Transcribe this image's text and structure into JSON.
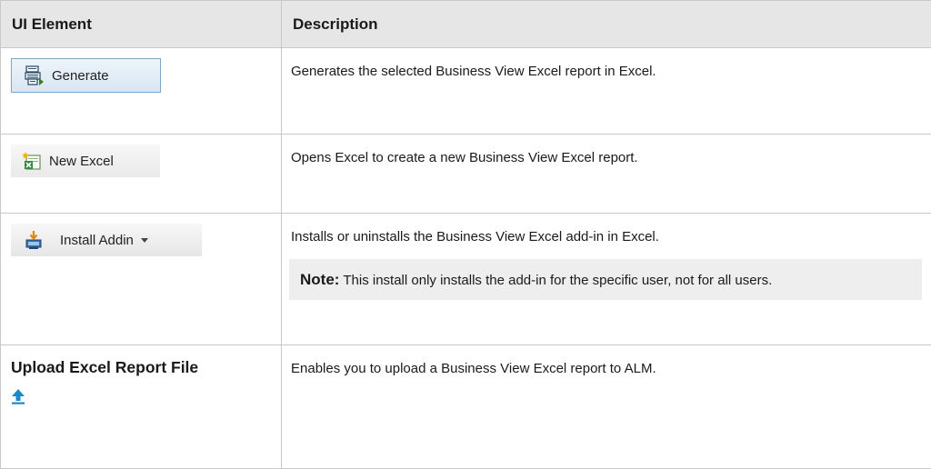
{
  "table": {
    "headers": [
      "UI Element",
      "Description"
    ],
    "rows": [
      {
        "element": {
          "kind": "button",
          "label": "Generate",
          "icon": "generate-report-icon"
        },
        "description": "Generates the selected Business View Excel report in Excel."
      },
      {
        "element": {
          "kind": "button",
          "label": "New Excel",
          "icon": "new-excel-icon"
        },
        "description": "Opens Excel to create a new Business View Excel report."
      },
      {
        "element": {
          "kind": "dropdown-button",
          "label": "Install Addin",
          "icon": "install-addin-icon"
        },
        "description": "Installs or uninstalls the Business View Excel add-in in Excel.",
        "note": {
          "label": "Note:",
          "text": "This install only installs the add-in for the specific user, not for all users."
        }
      },
      {
        "element": {
          "kind": "text-with-icon",
          "label": "Upload Excel Report File",
          "icon": "upload-arrow-icon"
        },
        "description": "Enables you to upload a Business View Excel report to ALM."
      }
    ]
  },
  "colors": {
    "header_bg": "#e6e6e6",
    "border": "#c8c8c8",
    "note_bg": "#eeeeee",
    "upload_icon": "#1e88c8"
  }
}
